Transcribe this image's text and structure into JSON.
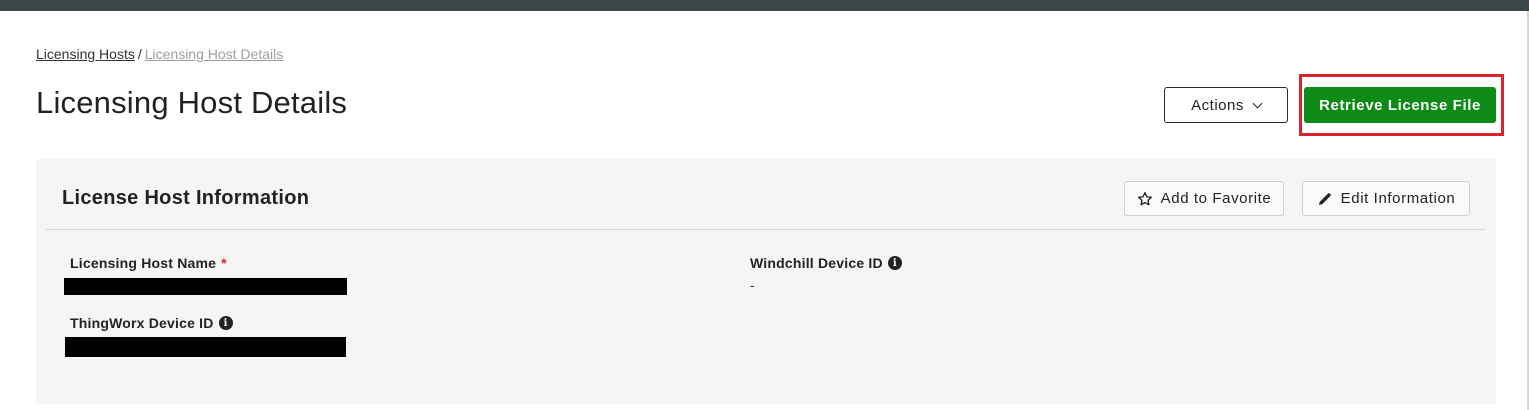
{
  "breadcrumb": {
    "items": [
      "Licensing Hosts",
      "Licensing Host Details"
    ],
    "separator": "/"
  },
  "page": {
    "title": "Licensing Host Details"
  },
  "header_actions": {
    "actions_label": "Actions",
    "retrieve_label": "Retrieve License File"
  },
  "panel": {
    "title": "License Host Information",
    "favorite_label": "Add to Favorite",
    "edit_label": "Edit Information",
    "fields": {
      "host_name_label": "Licensing Host Name",
      "required_marker": "*",
      "thingworx_label": "ThingWorx Device ID",
      "windchill_label": "Windchill Device ID",
      "windchill_value": "-"
    }
  },
  "colors": {
    "primary_green": "#0e8a16",
    "highlight_red": "#d9232e",
    "top_bar": "#3d4548",
    "panel_bg": "#f5f5f5"
  },
  "icons": [
    "chevron-down-icon",
    "star-outline-icon",
    "pencil-icon",
    "info-icon"
  ]
}
